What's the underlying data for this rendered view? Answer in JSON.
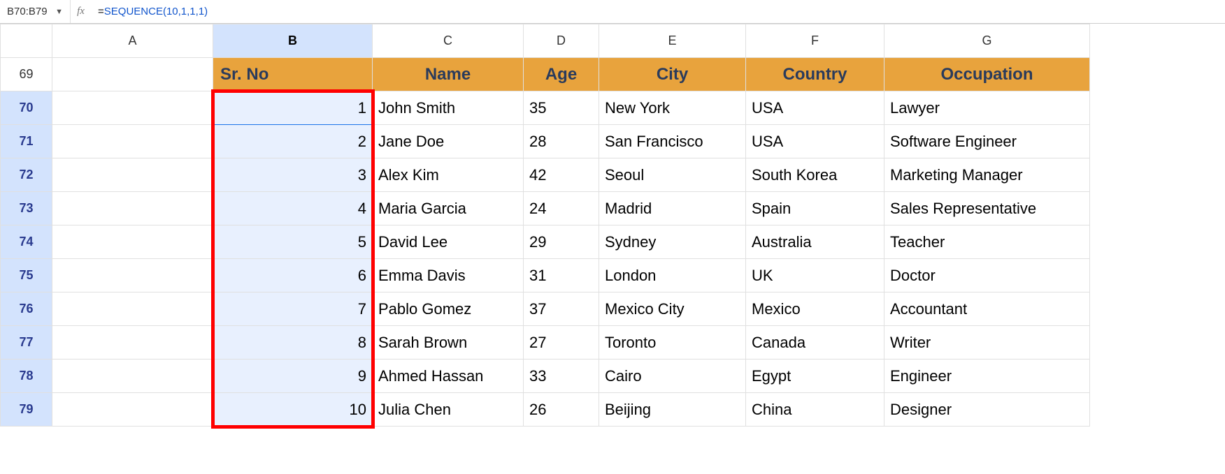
{
  "formula_bar": {
    "name_box": "B70:B79",
    "fx_label": "fx",
    "formula_prefix": "=",
    "formula_func": "SEQUENCE",
    "formula_args": "(10,1,1,1)"
  },
  "columns": [
    "A",
    "B",
    "C",
    "D",
    "E",
    "F",
    "G"
  ],
  "row_numbers": [
    69,
    70,
    71,
    72,
    73,
    74,
    75,
    76,
    77,
    78,
    79
  ],
  "headers": {
    "srno": "Sr. No",
    "name": "Name",
    "age": "Age",
    "city": "City",
    "country": "Country",
    "occupation": "Occupation"
  },
  "rows": [
    {
      "sr": 1,
      "name": "John Smith",
      "age": 35,
      "city": "New York",
      "country": "USA",
      "occupation": "Lawyer"
    },
    {
      "sr": 2,
      "name": "Jane Doe",
      "age": 28,
      "city": "San Francisco",
      "country": "USA",
      "occupation": "Software Engineer"
    },
    {
      "sr": 3,
      "name": "Alex Kim",
      "age": 42,
      "city": "Seoul",
      "country": "South Korea",
      "occupation": "Marketing Manager"
    },
    {
      "sr": 4,
      "name": "Maria Garcia",
      "age": 24,
      "city": "Madrid",
      "country": "Spain",
      "occupation": "Sales Representative"
    },
    {
      "sr": 5,
      "name": "David Lee",
      "age": 29,
      "city": "Sydney",
      "country": "Australia",
      "occupation": "Teacher"
    },
    {
      "sr": 6,
      "name": "Emma Davis",
      "age": 31,
      "city": "London",
      "country": "UK",
      "occupation": "Doctor"
    },
    {
      "sr": 7,
      "name": "Pablo Gomez",
      "age": 37,
      "city": "Mexico City",
      "country": "Mexico",
      "occupation": "Accountant"
    },
    {
      "sr": 8,
      "name": "Sarah Brown",
      "age": 27,
      "city": "Toronto",
      "country": "Canada",
      "occupation": "Writer"
    },
    {
      "sr": 9,
      "name": "Ahmed Hassan",
      "age": 33,
      "city": "Cairo",
      "country": "Egypt",
      "occupation": "Engineer"
    },
    {
      "sr": 10,
      "name": "Julia Chen",
      "age": 26,
      "city": "Beijing",
      "country": "China",
      "occupation": "Designer"
    }
  ]
}
